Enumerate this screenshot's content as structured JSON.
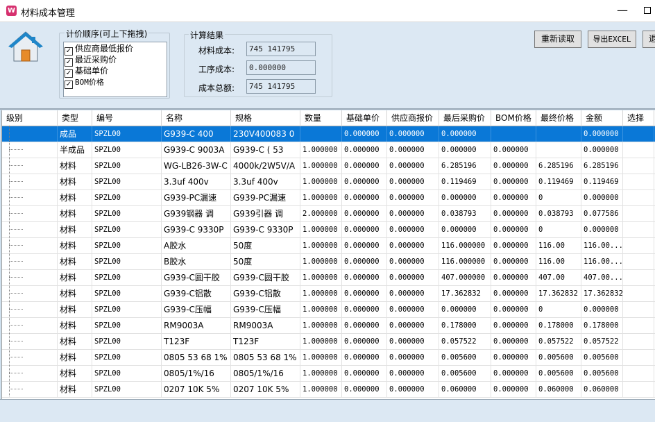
{
  "window": {
    "title": "材料成本管理",
    "app_icon_glyph": "W",
    "minimize_glyph": "—"
  },
  "pricing_order": {
    "legend": "计价顺序(可上下拖拽)",
    "items": [
      {
        "label": "供应商最低报价",
        "checked": true
      },
      {
        "label": "最近采购价",
        "checked": true
      },
      {
        "label": "基础单价",
        "checked": true
      },
      {
        "label": "BOM价格",
        "checked": true
      }
    ]
  },
  "results": {
    "legend": "计算结果",
    "material_cost_label": "材料成本:",
    "material_cost_value": "745 141795",
    "process_cost_label": "工序成本:",
    "process_cost_value": "0.000000",
    "total_cost_label": "成本总额:",
    "total_cost_value": "745 141795"
  },
  "toolbar": {
    "reload_label": "重新读取",
    "export_label": "导出EXCEL",
    "exit_label": "退出"
  },
  "table": {
    "columns": [
      "级别",
      "类型",
      "编号",
      "名称",
      "规格",
      "数量",
      "基础单价",
      "供应商报价",
      "最后采购价",
      "BOM价格",
      "最终价格",
      "金额",
      "选择"
    ],
    "rows": [
      [
        "",
        "成品",
        "SPZL00",
        "G939-C   400",
        "230V400083 0",
        "",
        "0.000000",
        "0.000000",
        "0.000000",
        "",
        "",
        "0.000000",
        ""
      ],
      [
        "",
        "半成品",
        "SPZL00",
        "G939-C 9003A",
        "G939-C ( 53",
        "1.000000",
        "0.000000",
        "0.000000",
        "0.000000",
        "0.000000",
        "",
        "0.000000",
        ""
      ],
      [
        "",
        "材料",
        "SPZL00",
        "WG-LB26-3W-C",
        "4000k/2W5V/A",
        "1.000000",
        "0.000000",
        "0.000000",
        "6.285196",
        "0.000000",
        "6.285196",
        "6.285196",
        ""
      ],
      [
        "",
        "材料",
        "SPZL00",
        "3.3uf 400v",
        "3.3uf 400v",
        "1.000000",
        "0.000000",
        "0.000000",
        "0.119469",
        "0.000000",
        "0.119469",
        "0.119469",
        ""
      ],
      [
        "",
        "材料",
        "SPZL00",
        "G939-PC漏速",
        "G939-PC漏速",
        "1.000000",
        "0.000000",
        "0.000000",
        "0.000000",
        "0.000000",
        "0",
        "0.000000",
        ""
      ],
      [
        "",
        "材料",
        "SPZL00",
        "G939钢器 调",
        "G939引器 调",
        "2.000000",
        "0.000000",
        "0.000000",
        "0.038793",
        "0.000000",
        "0.038793",
        "0.077586",
        ""
      ],
      [
        "",
        "材料",
        "SPZL00",
        "G939-C 9330P",
        "G939-C 9330P",
        "1.000000",
        "0.000000",
        "0.000000",
        "0.000000",
        "0.000000",
        "0",
        "0.000000",
        ""
      ],
      [
        "",
        "材料",
        "SPZL00",
        "A胶水",
        "50度",
        "1.000000",
        "0.000000",
        "0.000000",
        "116.000000",
        "0.000000",
        "116.00",
        "116.00...",
        ""
      ],
      [
        "",
        "材料",
        "SPZL00",
        "B胶水",
        "50度",
        "1.000000",
        "0.000000",
        "0.000000",
        "116.000000",
        "0.000000",
        "116.00",
        "116.00...",
        ""
      ],
      [
        "",
        "材料",
        "SPZL00",
        "G939-C圆干胶",
        "G939-C圆干胶",
        "1.000000",
        "0.000000",
        "0.000000",
        "407.000000",
        "0.000000",
        "407.00",
        "407.00...",
        ""
      ],
      [
        "",
        "材料",
        "SPZL00",
        "G939-C铝散",
        "G939-C铝散",
        "1.000000",
        "0.000000",
        "0.000000",
        "17.362832",
        "0.000000",
        "17.362832",
        "17.362832",
        ""
      ],
      [
        "",
        "材料",
        "SPZL00",
        "G939-C压幅",
        "G939-C压幅",
        "1.000000",
        "0.000000",
        "0.000000",
        "0.000000",
        "0.000000",
        "0",
        "0.000000",
        ""
      ],
      [
        "",
        "材料",
        "SPZL00",
        "RM9003A",
        "RM9003A",
        "1.000000",
        "0.000000",
        "0.000000",
        "0.178000",
        "0.000000",
        "0.178000",
        "0.178000",
        ""
      ],
      [
        "",
        "材料",
        "SPZL00",
        "T123F",
        "T123F",
        "1.000000",
        "0.000000",
        "0.000000",
        "0.057522",
        "0.000000",
        "0.057522",
        "0.057522",
        ""
      ],
      [
        "",
        "材料",
        "SPZL00",
        "0805 53 68 1%",
        "0805 53 68 1%",
        "1.000000",
        "0.000000",
        "0.000000",
        "0.005600",
        "0.000000",
        "0.005600",
        "0.005600",
        ""
      ],
      [
        "",
        "材料",
        "SPZL00",
        "0805/1%/16",
        "0805/1%/16",
        "1.000000",
        "0.000000",
        "0.000000",
        "0.005600",
        "0.000000",
        "0.005600",
        "0.005600",
        ""
      ],
      [
        "",
        "材料",
        "SPZL00",
        "0207 10K 5%",
        "0207 10K 5%",
        "1.000000",
        "0.000000",
        "0.000000",
        "0.060000",
        "0.000000",
        "0.060000",
        "0.060000",
        ""
      ]
    ]
  },
  "colors": {
    "selection": "#0a78d7",
    "window_bg": "#dce8f3"
  }
}
